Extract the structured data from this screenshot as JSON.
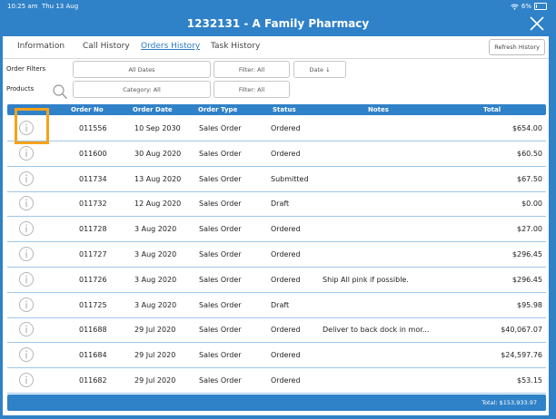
{
  "status_bar": {
    "time": "10:25 am",
    "date": "Thu 13 Aug",
    "battery": "6%"
  },
  "header": {
    "title": "1232131 - A Family Pharmacy"
  },
  "tabs": [
    {
      "label": "Information",
      "active": false
    },
    {
      "label": "Call History",
      "active": false
    },
    {
      "label": "Orders History",
      "active": true
    },
    {
      "label": "Task History",
      "active": false
    }
  ],
  "refresh_label": "Refresh History",
  "filters": {
    "order_filters_label": "Order Filters",
    "products_label": "Products",
    "dates": "All Dates",
    "filter1": "Filter: All",
    "sort": "Date ↓",
    "category": "Category: All",
    "filter2": "Filter: All"
  },
  "columns": [
    "Order No",
    "Order Date",
    "Order Type",
    "Status",
    "Notes",
    "Total"
  ],
  "rows": [
    {
      "order_no": "011556",
      "date": "10 Sep 2030",
      "type": "Sales Order",
      "status": "Ordered",
      "notes": "",
      "total": "$654.00"
    },
    {
      "order_no": "011600",
      "date": "30 Aug 2020",
      "type": "Sales Order",
      "status": "Ordered",
      "notes": "",
      "total": "$60.50"
    },
    {
      "order_no": "011734",
      "date": "13 Aug 2020",
      "type": "Sales Order",
      "status": "Submitted",
      "notes": "",
      "total": "$67.50"
    },
    {
      "order_no": "011732",
      "date": "12 Aug 2020",
      "type": "Sales Order",
      "status": "Draft",
      "notes": "",
      "total": "$0.00"
    },
    {
      "order_no": "011728",
      "date": "3 Aug 2020",
      "type": "Sales Order",
      "status": "Ordered",
      "notes": "",
      "total": "$27.00"
    },
    {
      "order_no": "011727",
      "date": "3 Aug 2020",
      "type": "Sales Order",
      "status": "Ordered",
      "notes": "",
      "total": "$296.45"
    },
    {
      "order_no": "011726",
      "date": "3 Aug 2020",
      "type": "Sales Order",
      "status": "Ordered",
      "notes": "Ship All pink if possible.",
      "total": "$296.45"
    },
    {
      "order_no": "011725",
      "date": "3 Aug 2020",
      "type": "Sales Order",
      "status": "Draft",
      "notes": "",
      "total": "$95.98"
    },
    {
      "order_no": "011688",
      "date": "29 Jul 2020",
      "type": "Sales Order",
      "status": "Ordered",
      "notes": "Deliver to back dock in mor...",
      "total": "$40,067.07"
    },
    {
      "order_no": "011684",
      "date": "29 Jul 2020",
      "type": "Sales Order",
      "status": "Ordered",
      "notes": "",
      "total": "$24,597.76"
    },
    {
      "order_no": "011682",
      "date": "29 Jul 2020",
      "type": "Sales Order",
      "status": "Ordered",
      "notes": "",
      "total": "$53.15"
    }
  ],
  "footer_total": "Total: $153,933.97",
  "colors": {
    "accent": "#2f81c8",
    "highlight": "#f6a21b",
    "active_tab": "#2a79c6"
  }
}
